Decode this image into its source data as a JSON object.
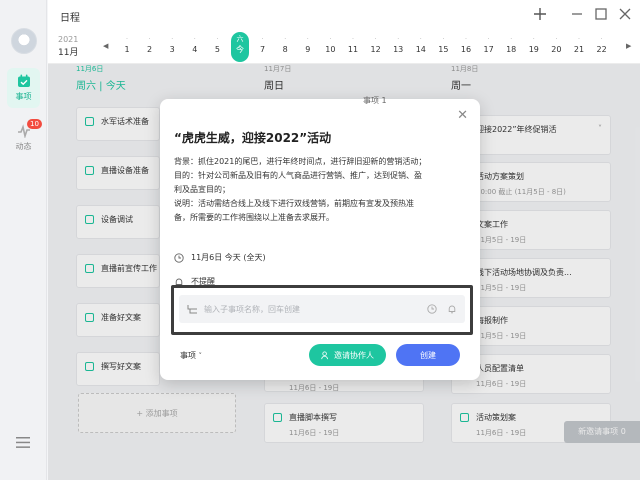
{
  "app": {
    "title": "日程"
  },
  "sidebar": {
    "items": [
      {
        "label": "事项",
        "active": true
      },
      {
        "label": "动态",
        "badge": "10"
      }
    ]
  },
  "datebar": {
    "year": "2021",
    "month": "11月",
    "days": [
      {
        "num": "1"
      },
      {
        "num": "2"
      },
      {
        "num": "3"
      },
      {
        "num": "4"
      },
      {
        "num": "5"
      },
      {
        "dow": "六",
        "num": "今",
        "today": true
      },
      {
        "num": "7"
      },
      {
        "num": "8"
      },
      {
        "num": "9"
      },
      {
        "num": "10"
      },
      {
        "num": "11"
      },
      {
        "num": "12"
      },
      {
        "num": "13"
      },
      {
        "num": "14"
      },
      {
        "num": "15"
      },
      {
        "num": "16"
      },
      {
        "num": "17"
      },
      {
        "num": "18"
      },
      {
        "num": "19"
      },
      {
        "num": "20"
      },
      {
        "num": "21"
      },
      {
        "num": "22"
      }
    ]
  },
  "columns": [
    {
      "date": "11月6日",
      "day": "周六 | 今天",
      "count_label": "事项 1"
    },
    {
      "date": "11月7日",
      "day": "周日"
    },
    {
      "date": "11月8日",
      "day": "周一"
    }
  ],
  "col1_cards": [
    "水军话术准备",
    "直播设备准备",
    "设备调试",
    "直播前宣传工作",
    "准备好文案",
    "撰写好文案"
  ],
  "col2_cards": [
    {
      "title": "直播脚本撰写",
      "range": "11月6日 - 19日"
    },
    {
      "title": "",
      "range": "11月6日 - 19日"
    }
  ],
  "col3_cards": [
    {
      "title": "迎接2022”年终促销活",
      "range": ""
    },
    {
      "title": "活动方案策划",
      "range": "20:00 截止 (11月5日 - 8日)"
    },
    {
      "title": "文案工作",
      "range": "11月5日 - 19日"
    },
    {
      "title": "线下活动场地协调及负责...",
      "range": "11月5日 - 19日"
    },
    {
      "title": "海报制作",
      "range": "11月5日 - 19日"
    },
    {
      "title": "人员配置清单",
      "range": "11月6日 - 19日"
    },
    {
      "title": "活动策划案",
      "range": "11月6日 - 19日"
    }
  ],
  "add_task_label": "+ 添加事项",
  "new_invite_label": "新邀请事项 0",
  "modal": {
    "title": "“虎虎生威，迎接2022”活动",
    "desc_lines": [
      "背景：抓住2021的尾巴，进行年终时间点，进行辞旧迎新的营销活动；",
      "目的：针对公司新品及旧有的人气商品进行营销、推广，达到促销、盈",
      "利及品宣目的；",
      "说明：活动需结合线上及线下进行双线营销，前期应有宣发及预热准",
      "备，所需要的工作将围绕以上准备去求展开。"
    ],
    "date_text": "11月6日 今天 (全天)",
    "reminder_text": "不提醒",
    "subtask_placeholder": "输入子事项名称，回车创建",
    "type_label": "事项",
    "invite_label": "邀请协作人",
    "create_label": "创建"
  },
  "colors": {
    "accent": "#1ec6a0",
    "primary_blue": "#4f74f4",
    "badge_red": "#f24b3f"
  }
}
